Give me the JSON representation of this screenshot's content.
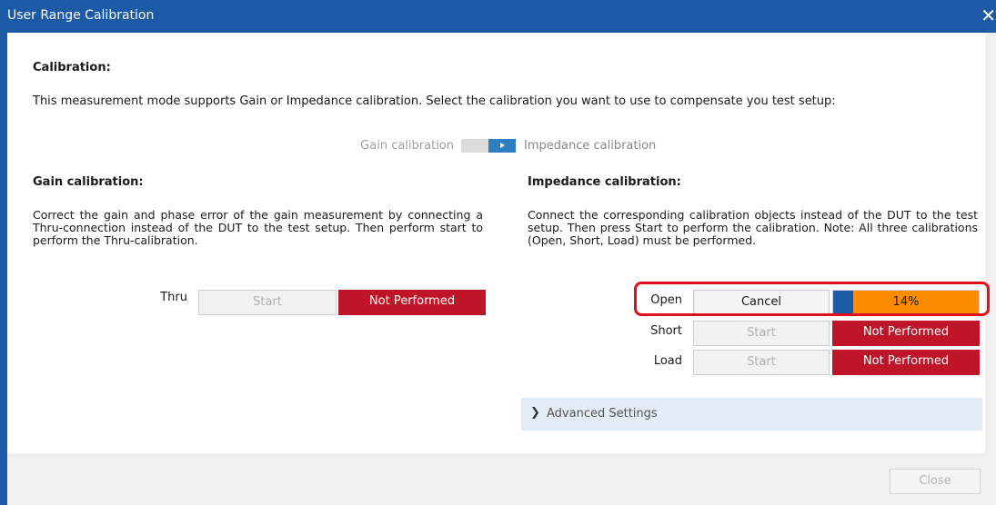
{
  "window": {
    "title": "User Range Calibration",
    "close_glyph": "✕"
  },
  "calibration": {
    "heading": "Calibration:",
    "description": "This measurement mode supports Gain or Impedance calibration. Select the calibration you want to use to compensate you test setup:",
    "toggle_left_label": "Gain calibration",
    "toggle_right_label": "Impedance calibration"
  },
  "gain": {
    "heading": "Gain calibration:",
    "description": "Correct the gain and phase error of the gain measurement by connecting a Thru-connection instead of the DUT to the test setup. Then perform start to perform the Thru-calibration.",
    "rows": [
      {
        "label": "Thru",
        "button": "Start",
        "status": "Not Performed"
      }
    ]
  },
  "impedance": {
    "heading": "Impedance calibration:",
    "description": "Connect the corresponding calibration objects instead of the DUT to the test setup. Then press Start to perform the calibration. Note: All three calibrations (Open, Short, Load) must be performed.",
    "rows": [
      {
        "label": "Open",
        "button": "Cancel",
        "status": "14%",
        "progress": 0.14
      },
      {
        "label": "Short",
        "button": "Start",
        "status": "Not Performed"
      },
      {
        "label": "Load",
        "button": "Start",
        "status": "Not Performed"
      }
    ]
  },
  "advanced": {
    "label": "Advanced Settings"
  },
  "footer": {
    "close_label": "Close"
  },
  "colors": {
    "titlebar": "#1c5aa6",
    "not_performed": "#be1628",
    "progress_bg": "#fb8c00",
    "progress_fill": "#1c5aa6",
    "highlight": "#e0101a"
  }
}
